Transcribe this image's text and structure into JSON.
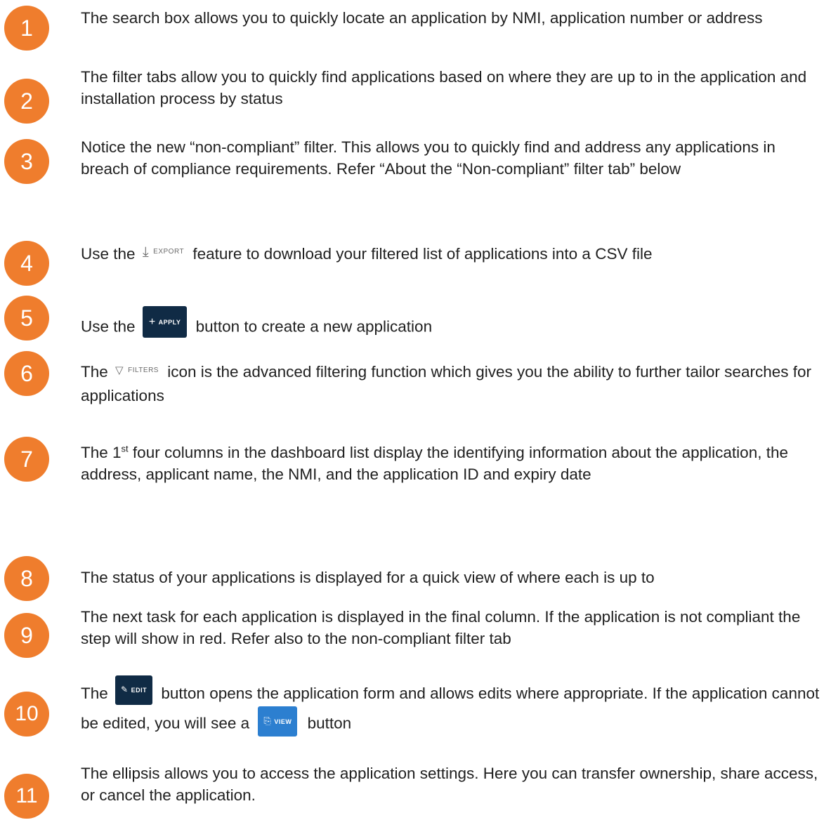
{
  "accent_color": "#ef7d2d",
  "items": [
    {
      "number": "1",
      "text": "The search box allows you to quickly locate an application by NMI, application number or address"
    },
    {
      "number": "2",
      "text": "The filter tabs allow you to quickly find applications based on where they are up to in the application and installation process by status"
    },
    {
      "number": "3",
      "text": "Notice the new “non-compliant” filter. This allows you to quickly find and address any applications in breach of compliance requirements. Refer “About the “Non-compliant” filter tab” below"
    },
    {
      "number": "4",
      "before": "Use the",
      "after": "feature to download your filtered list of applications into a CSV file",
      "chip_label": "EXPORT",
      "chip_icon": "download-arrow-icon"
    },
    {
      "number": "5",
      "before": "Use the",
      "after": "button to create a new application",
      "chip_label": "APPLY",
      "chip_icon": "plus-icon"
    },
    {
      "number": "6",
      "before": "The",
      "after": "icon is the advanced filtering function which gives you the ability to further tailor searches for applications",
      "chip_label": "FILTERS",
      "chip_icon": "funnel-icon"
    },
    {
      "number": "7",
      "before": "The 1",
      "sup": "st",
      "after": " four columns in the dashboard list display the identifying information about the application, the address, applicant name, the NMI, and the application ID and expiry date"
    },
    {
      "number": "8",
      "text": "The status of your applications is displayed for a quick view of where each is up to"
    },
    {
      "number": "9",
      "text": "The next task for each application is displayed in the final column. If the application is not compliant the step will show in red. Refer also to the non-compliant filter tab"
    },
    {
      "number": "10",
      "before": "The",
      "middle": "button opens the application form and allows edits where appropriate. If the application cannot be edited, you will see a",
      "after": "button",
      "chip_label": "EDIT",
      "chip_icon": "pencil-icon",
      "chip2_label": "VIEW",
      "chip2_icon": "document-view-icon"
    },
    {
      "number": "11",
      "text": "The ellipsis allows you to access the application settings. Here you can transfer ownership, share access, or cancel the application."
    }
  ]
}
